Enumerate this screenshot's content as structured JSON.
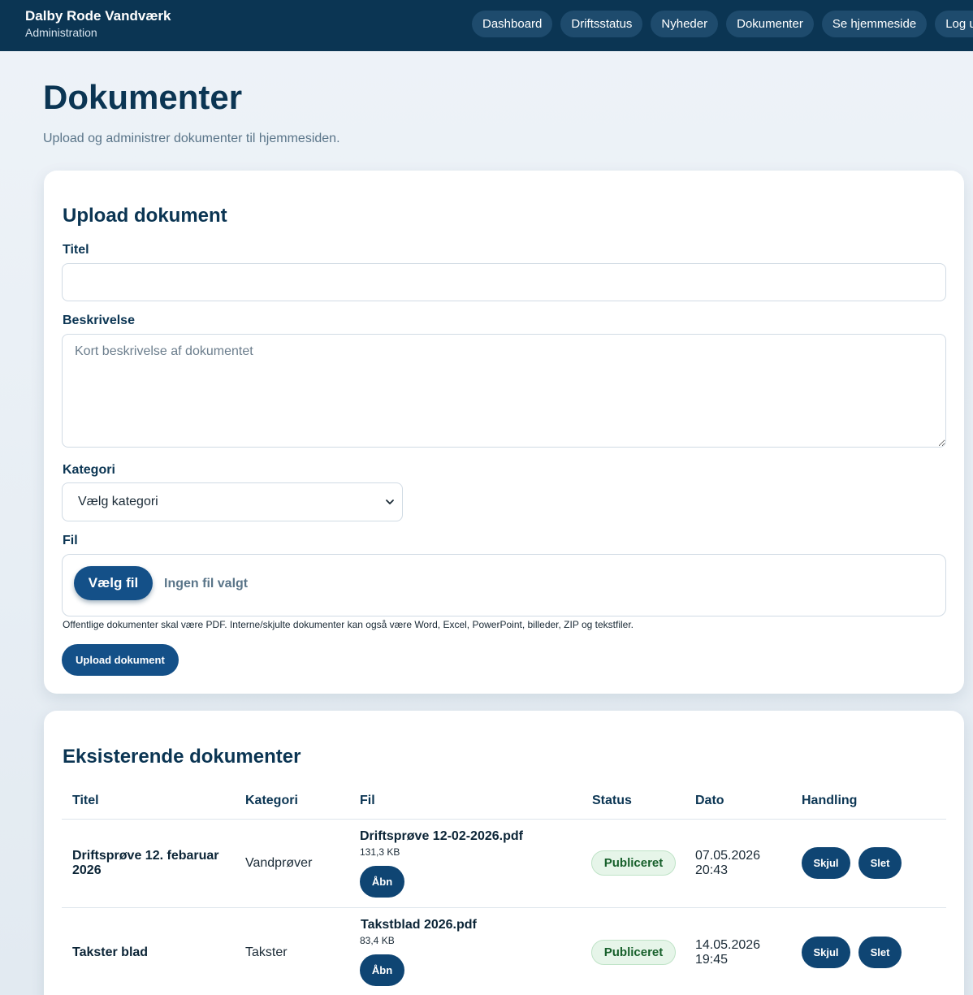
{
  "brand": {
    "name": "Dalby Rode Vandværk",
    "subtitle": "Administration"
  },
  "nav": [
    "Dashboard",
    "Driftsstatus",
    "Nyheder",
    "Dokumenter",
    "Se hjemmeside",
    "Log ud"
  ],
  "page": {
    "title": "Dokumenter",
    "subtitle": "Upload og administrer dokumenter til hjemmesiden."
  },
  "upload": {
    "heading": "Upload dokument",
    "title_label": "Titel",
    "title_value": "",
    "description_label": "Beskrivelse",
    "description_placeholder": "Kort beskrivelse af dokumentet",
    "category_label": "Kategori",
    "category_selected": "Vælg kategori",
    "file_label": "Fil",
    "file_button": "Vælg fil",
    "file_none": "Ingen fil valgt",
    "hint": "Offentlige dokumenter skal være PDF. Interne/skjulte dokumenter kan også være Word, Excel, PowerPoint, billeder, ZIP og tekstfiler.",
    "submit": "Upload dokument"
  },
  "existing": {
    "heading": "Eksisterende dokumenter",
    "columns": [
      "Titel",
      "Kategori",
      "Fil",
      "Status",
      "Dato",
      "Handling"
    ],
    "rows": [
      {
        "title": "Driftsprøve 12. febaruar 2026",
        "category": "Vandprøver",
        "file_name": "Driftsprøve 12-02-2026.pdf",
        "file_size": "131,3 KB",
        "open": "Åbn",
        "status": "Publiceret",
        "date": "07.05.2026",
        "time": "20:43",
        "hide": "Skjul",
        "delete": "Slet"
      },
      {
        "title": "Takster blad",
        "category": "Takster",
        "file_name": "Takstblad 2026.pdf",
        "file_size": "83,4 KB",
        "open": "Åbn",
        "status": "Publiceret",
        "date": "14.05.2026",
        "time": "19:45",
        "hide": "Skjul",
        "delete": "Slet"
      }
    ]
  }
}
